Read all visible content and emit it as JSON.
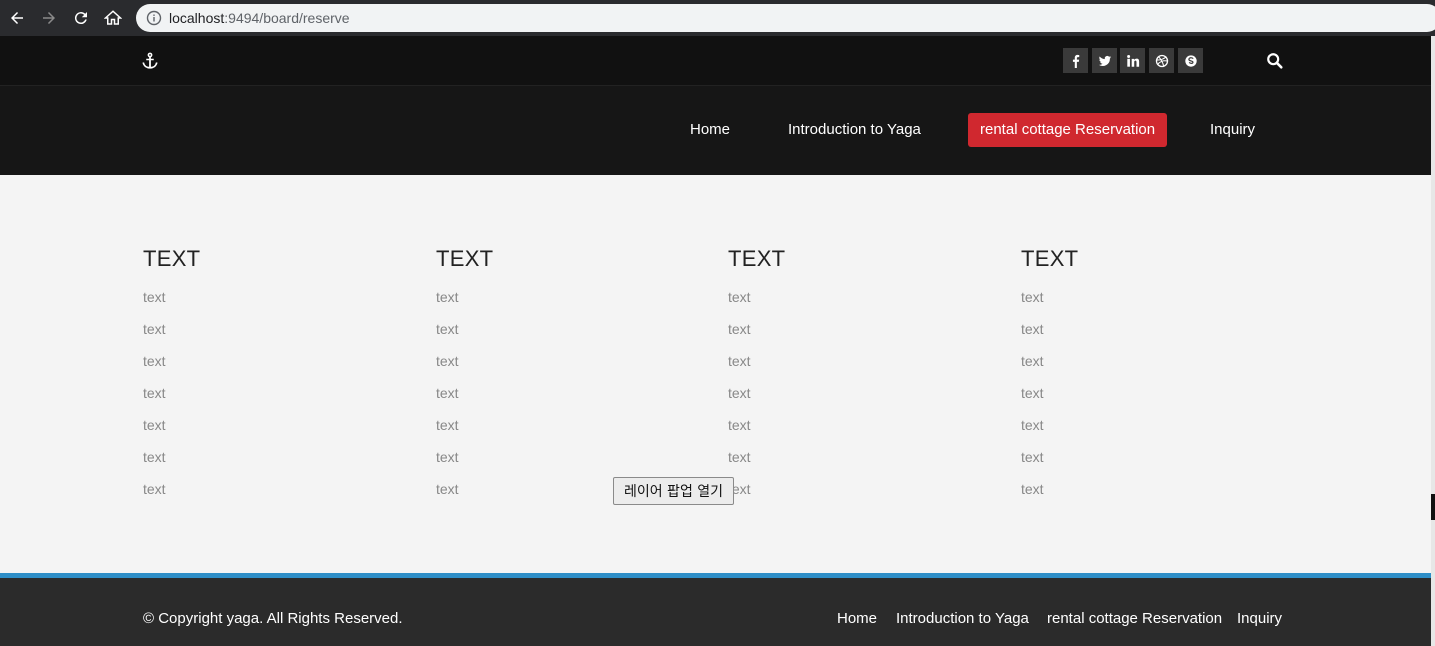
{
  "browser": {
    "url_host": "localhost",
    "url_rest": ":9494/board/reserve"
  },
  "topbar": {
    "social_icons": [
      "facebook-icon",
      "twitter-icon",
      "linkedin-icon",
      "dribbble-icon",
      "skype-icon"
    ]
  },
  "nav": {
    "items": [
      {
        "label": "Home"
      },
      {
        "label": "Introduction to Yaga"
      },
      {
        "label": "rental cottage Reservation",
        "active": true
      },
      {
        "label": "Inquiry"
      }
    ],
    "active_color": "#d0282f"
  },
  "columns": [
    {
      "title": "TEXT",
      "items": [
        "text",
        "text",
        "text",
        "text",
        "text",
        "text",
        "text"
      ]
    },
    {
      "title": "TEXT",
      "items": [
        "text",
        "text",
        "text",
        "text",
        "text",
        "text",
        "text"
      ]
    },
    {
      "title": "TEXT",
      "items": [
        "text",
        "text",
        "text",
        "text",
        "text",
        "text",
        "text"
      ]
    },
    {
      "title": "TEXT",
      "items": [
        "text",
        "text",
        "text",
        "text",
        "text",
        "text",
        "text"
      ]
    }
  ],
  "popup_button": {
    "label": "레이어 팝업 열기"
  },
  "footer": {
    "copyright": "© Copyright yaga. All Rights Reserved.",
    "links": [
      "Home",
      "Introduction to Yaga",
      "rental cottage Reservation",
      "Inquiry"
    ],
    "accent_color": "#2e8ec7"
  }
}
